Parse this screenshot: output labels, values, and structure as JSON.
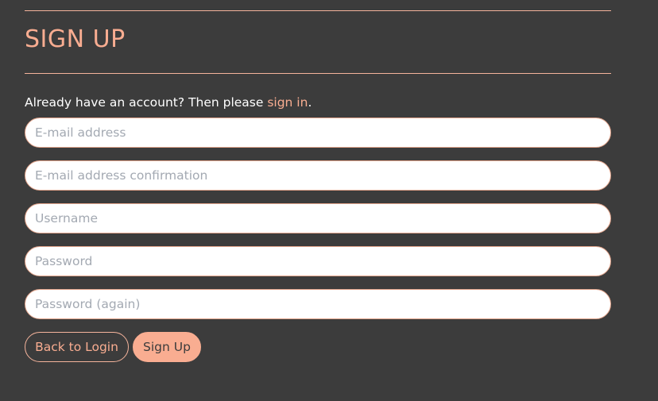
{
  "page": {
    "title": "SIGN UP"
  },
  "signin": {
    "prefix": "Already have an account? Then please ",
    "link_label": "sign in",
    "suffix": "."
  },
  "form": {
    "email_placeholder": "E-mail address",
    "email_value": "",
    "email_confirm_placeholder": "E-mail address confirmation",
    "email_confirm_value": "",
    "username_placeholder": "Username",
    "username_value": "",
    "password_placeholder": "Password",
    "password_value": "",
    "password_again_placeholder": "Password (again)",
    "password_again_value": ""
  },
  "buttons": {
    "back_label": "Back to Login",
    "signup_label": "Sign Up"
  },
  "colors": {
    "background": "#3c3c3c",
    "accent": "#f9ad91",
    "text": "#ffffff",
    "placeholder": "#a3a9b2"
  }
}
